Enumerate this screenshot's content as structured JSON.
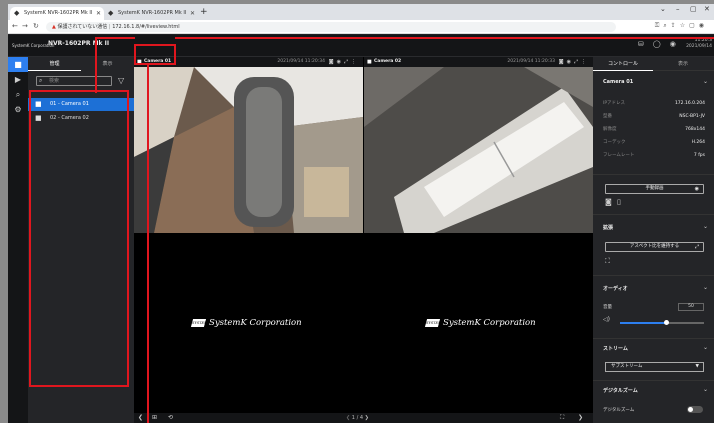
{
  "browser": {
    "tabs": [
      {
        "title": "SystemK NVR-1602PR Mk II"
      },
      {
        "title": "SystemK NVR-1602PR Mk II"
      }
    ],
    "new_tab": "+",
    "address": {
      "security_warning": "保護されていない通信",
      "url": "172.16.1.8/#/liveview.html"
    }
  },
  "app": {
    "logo_text": "SystemK Corporation",
    "title": "NVR-1602PR Mk II",
    "clock": {
      "time": "11:20:3",
      "date": "2021/09/14"
    }
  },
  "sidebar": {
    "tabs": [
      {
        "label": "管理"
      },
      {
        "label": "表示"
      }
    ],
    "search_placeholder": "検索",
    "cameras": [
      {
        "label": "01 - Camera 01"
      },
      {
        "label": "02 - Camera 02"
      }
    ]
  },
  "grid": {
    "cells": [
      {
        "camera": "Camera 01",
        "timestamp": "2021/09/14 11:20:34"
      },
      {
        "camera": "Camera 02",
        "timestamp": "2021/09/14 11:20:33"
      }
    ],
    "placeholder_brand": "SystemK Corporation",
    "placeholder_emblem": "SYSTEM K",
    "page_indicator": "1 / 4"
  },
  "right_panel": {
    "tabs": [
      {
        "label": "コントロール"
      },
      {
        "label": "表示"
      }
    ],
    "camera_section": "Camera 01",
    "properties": [
      {
        "label": "IPアドレス",
        "value": "172.16.0.204"
      },
      {
        "label": "型番",
        "value": "NSC-BP1-JV"
      },
      {
        "label": "解像度",
        "value": "768x144"
      },
      {
        "label": "コーデック",
        "value": "H.264"
      },
      {
        "label": "フレームレート",
        "value": "7 fps"
      }
    ],
    "record_button": "手動録画",
    "zoom_section": "拡張",
    "aspect_button": "アスペクト比を維持する",
    "audio_section": "オーディオ",
    "volume_label": "音量",
    "volume_value": "50",
    "volume_level": 0.55,
    "stream_section": "ストリーム",
    "stream_select": "サブストリーム",
    "digital_zoom_section": "デジタルズーム",
    "digital_zoom_label": "デジタルズーム"
  },
  "colors": {
    "accent": "#2d7ff0",
    "annotation": "#e0161e",
    "selection": "#1d70d6"
  }
}
